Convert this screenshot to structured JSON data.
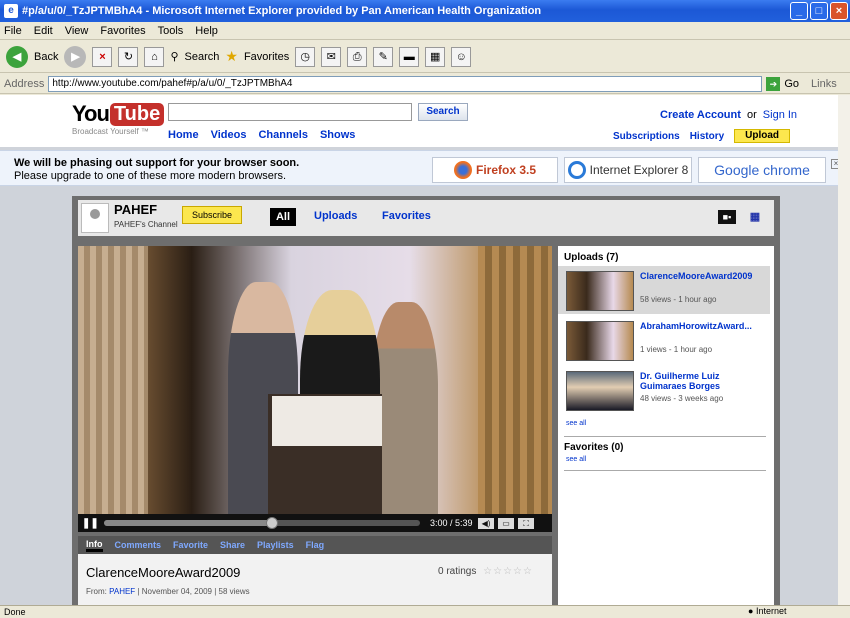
{
  "window": {
    "title": "#p/a/u/0/_TzJPTMBhA4 - Microsoft Internet Explorer provided by Pan American Health Organization"
  },
  "menu": [
    "File",
    "Edit",
    "View",
    "Favorites",
    "Tools",
    "Help"
  ],
  "toolbar": {
    "back_label": "Back",
    "search_label": "Search",
    "favorites_label": "Favorites"
  },
  "address": {
    "label": "Address",
    "url": "http://www.youtube.com/pahef#p/a/u/0/_TzJPTMBhA4",
    "go_label": "Go",
    "links_label": "Links"
  },
  "youtube": {
    "logo_you": "You",
    "logo_tube": "Tube",
    "tagline": "Broadcast Yourself ™",
    "search_button": "Search",
    "nav": [
      "Home",
      "Videos",
      "Channels",
      "Shows"
    ],
    "create_account": "Create Account",
    "or_text": "or",
    "sign_in": "Sign In",
    "subscriptions": "Subscriptions",
    "history": "History",
    "upload": "Upload"
  },
  "notice": {
    "line1": "We will be phasing out support for your browser soon.",
    "line2": "Please upgrade to one of these more modern browsers.",
    "firefox": "Firefox 3.5",
    "ie": "Internet Explorer 8",
    "chrome": "Google chrome"
  },
  "channel": {
    "name": "PAHEF",
    "sub": "PAHEF's Channel",
    "subscribe": "Subscribe",
    "tabs": {
      "all": "All",
      "uploads": "Uploads",
      "favorites": "Favorites"
    }
  },
  "player": {
    "time": "3:00 / 5:39",
    "progress_fraction": 0.531
  },
  "info_tabs": [
    "Info",
    "Comments",
    "Favorite",
    "Share",
    "Playlists",
    "Flag"
  ],
  "video": {
    "title": "ClarenceMooreAward2009",
    "ratings": "0 ratings",
    "stars": "☆☆☆☆☆",
    "from_prefix": "From: ",
    "from_user": "PAHEF",
    "from_rest": " | November 04, 2009 | 58 views"
  },
  "sidebar": {
    "uploads_heading": "Uploads (7)",
    "uploads": [
      {
        "title": "ClarenceMooreAward2009",
        "meta": "58 views - 1 hour ago"
      },
      {
        "title": "AbrahamHorowitzAward...",
        "meta": "1 views - 1 hour ago"
      },
      {
        "title": "Dr. Guilherme Luiz Guimaraes Borges",
        "meta": "48 views - 3 weeks ago"
      }
    ],
    "see_all": "see all",
    "favorites_heading": "Favorites (0)"
  },
  "status": {
    "left": "Done",
    "zone": "Internet"
  },
  "colors": {
    "link": "#0033cc",
    "youtube_red": "#c4302b",
    "upload_yellow": "#fce74e"
  }
}
